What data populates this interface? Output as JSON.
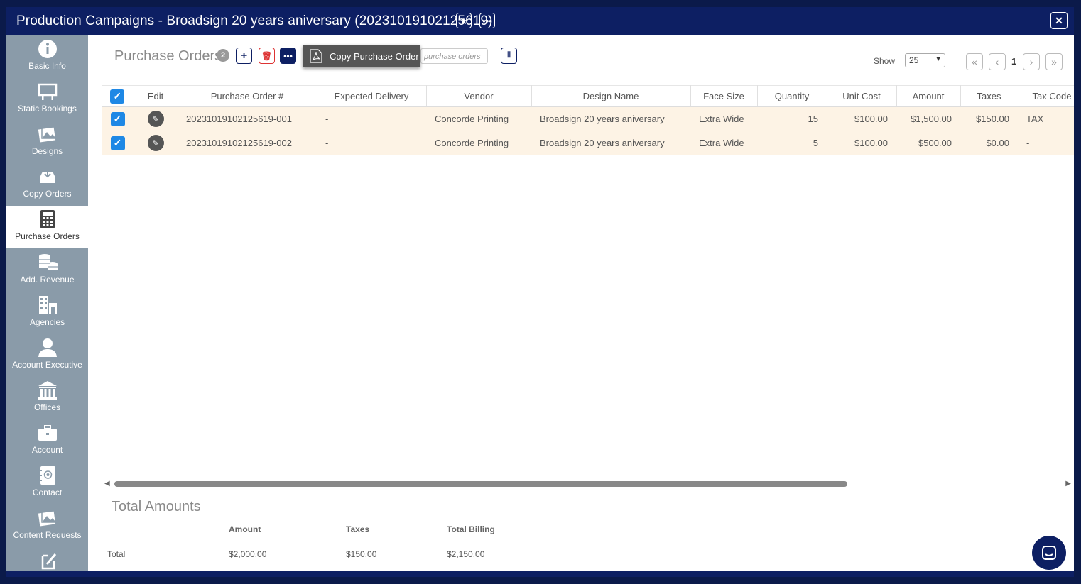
{
  "window": {
    "title": "Production Campaigns - Broadsign 20 years aniversary (20231019102125619)"
  },
  "sidebar": {
    "items": [
      {
        "label": "Basic Info",
        "icon": "info-icon"
      },
      {
        "label": "Static Bookings",
        "icon": "billboard-icon"
      },
      {
        "label": "Designs",
        "icon": "image-icon"
      },
      {
        "label": "Copy Orders",
        "icon": "inbox-icon"
      },
      {
        "label": "Purchase Orders",
        "icon": "calculator-icon",
        "active": true
      },
      {
        "label": "Add. Revenue",
        "icon": "coins-icon"
      },
      {
        "label": "Agencies",
        "icon": "building-icon"
      },
      {
        "label": "Account Executive",
        "icon": "user-icon"
      },
      {
        "label": "Offices",
        "icon": "bank-icon"
      },
      {
        "label": "Account",
        "icon": "briefcase-icon"
      },
      {
        "label": "Contact",
        "icon": "address-book-icon"
      },
      {
        "label": "Content Requests",
        "icon": "image-icon"
      },
      {
        "label": "",
        "icon": "edit-square-icon"
      }
    ]
  },
  "header": {
    "title": "Purchase Orders",
    "count": "2",
    "search_placeholder": "purchase orders",
    "tooltip": "Copy Purchase Order",
    "show_label": "Show",
    "show_value": "25",
    "current_page": "1"
  },
  "table": {
    "columns": [
      "Edit",
      "Purchase Order #",
      "Expected Delivery",
      "Vendor",
      "Design Name",
      "Face Size",
      "Quantity",
      "Unit Cost",
      "Amount",
      "Taxes",
      "Tax Code"
    ],
    "rows": [
      {
        "po": "20231019102125619-001",
        "delivery": "-",
        "vendor": "Concorde Printing",
        "design": "Broadsign 20 years aniversary",
        "face": "Extra Wide",
        "qty": "15",
        "unit": "$100.00",
        "amount": "$1,500.00",
        "taxes": "$150.00",
        "taxcode": "TAX"
      },
      {
        "po": "20231019102125619-002",
        "delivery": "-",
        "vendor": "Concorde Printing",
        "design": "Broadsign 20 years aniversary",
        "face": "Extra Wide",
        "qty": "5",
        "unit": "$100.00",
        "amount": "$500.00",
        "taxes": "$0.00",
        "taxcode": "-"
      }
    ]
  },
  "totals": {
    "title": "Total Amounts",
    "headers": {
      "amount": "Amount",
      "taxes": "Taxes",
      "billing": "Total Billing"
    },
    "row_label": "Total",
    "amount": "$2,000.00",
    "taxes": "$150.00",
    "billing": "$2,150.00"
  },
  "colors": {
    "primary": "#0d1f63",
    "sidebar": "#8a9ba9",
    "row_highlight": "#fdf3e5",
    "checkbox": "#1e88e5"
  }
}
